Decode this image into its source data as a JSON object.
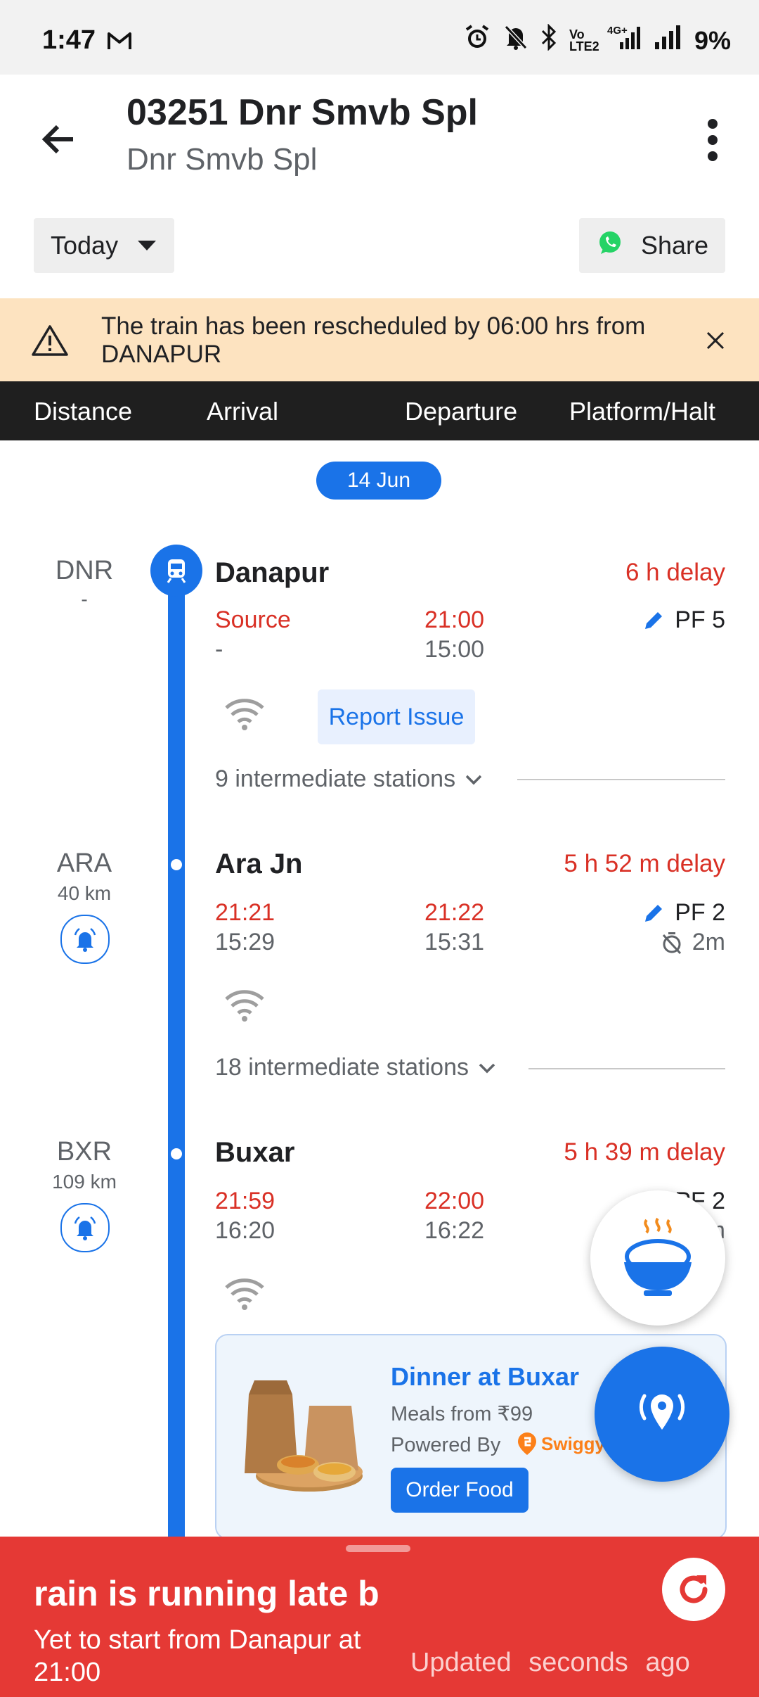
{
  "status_bar": {
    "time": "1:47",
    "battery": "9%",
    "icons": [
      "gmail-icon",
      "alarm-icon",
      "bell-off-icon",
      "bluetooth-icon",
      "volte-icon",
      "4g-signal-icon",
      "signal-icon"
    ],
    "volte": "Vo LTE2",
    "network": "4G+"
  },
  "app_bar": {
    "title": "03251 Dnr Smvb Spl",
    "subtitle": "Dnr Smvb Spl"
  },
  "filters": {
    "date_label": "Today",
    "share_label": "Share"
  },
  "alert": {
    "message": "The train has been rescheduled by 06:00 hrs from DANAPUR"
  },
  "columns": [
    "Distance",
    "Arrival",
    "Departure",
    "Platform/Halt"
  ],
  "date_pill": "14 Jun",
  "stations": [
    {
      "code": "DNR",
      "distance": "-",
      "name": "Danapur",
      "delay": "6 h delay",
      "arrival_actual": "Source",
      "arrival_sched": "-",
      "departure_actual": "21:00",
      "departure_sched": "15:00",
      "platform": "PF 5",
      "report_issue": "Report Issue",
      "intermediate": "9 intermediate stations"
    },
    {
      "code": "ARA",
      "distance": "40 km",
      "name": "Ara Jn",
      "delay": "5 h 52 m delay",
      "arrival_actual": "21:21",
      "arrival_sched": "15:29",
      "departure_actual": "21:22",
      "departure_sched": "15:31",
      "platform": "PF 2",
      "halt": "2m",
      "intermediate": "18 intermediate stations"
    },
    {
      "code": "BXR",
      "distance": "109 km",
      "name": "Buxar",
      "delay": "5 h 39 m delay",
      "arrival_actual": "21:59",
      "arrival_sched": "16:20",
      "departure_actual": "22:00",
      "departure_sched": "16:22",
      "platform": "PF 2",
      "halt": "2m"
    }
  ],
  "food_card": {
    "title": "Dinner at Buxar",
    "meals": "Meals from ₹99",
    "powered_by": "Powered By",
    "brand": "Swiggy",
    "order_label": "Order Food"
  },
  "bottom_sheet": {
    "marquee": "rain is running late b",
    "status": "Yet to start from Danapur at 21:00",
    "updated": "Updated seconds ago"
  },
  "colors": {
    "primary": "#1a73e8",
    "delay_red": "#d93025",
    "alert_bg": "#fde3c0",
    "bottom_bg": "#e53935",
    "header_bg": "#1f1f1f"
  }
}
